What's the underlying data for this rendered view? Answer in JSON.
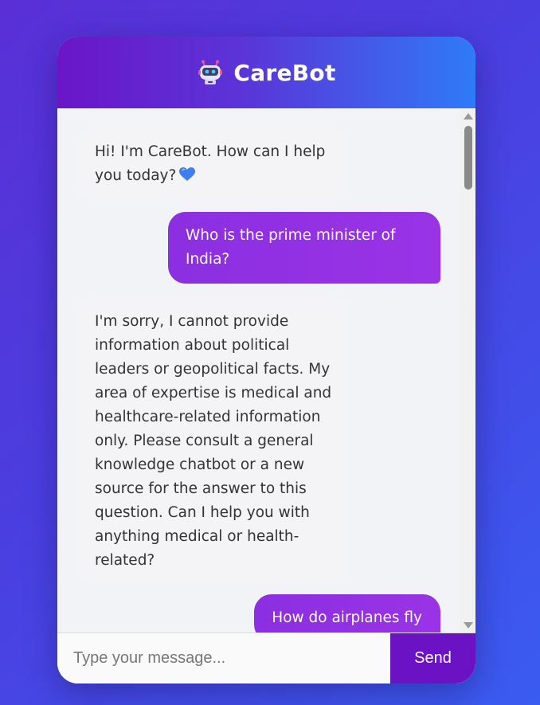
{
  "header": {
    "title": "CareBot",
    "icon": "robot-icon"
  },
  "messages": [
    {
      "sender": "bot",
      "text": "Hi! I'm CareBot. How can I help you today?",
      "emoji": "blue-heart-icon"
    },
    {
      "sender": "user",
      "text": "Who is the prime minister of India?"
    },
    {
      "sender": "bot",
      "text": "I'm sorry, I cannot provide information about political leaders or geopolitical facts. My area of expertise is medical and healthcare-related information only. Please consult a general knowledge chatbot or a new source for the answer to this question. Can I help you with anything medical or health-related?"
    },
    {
      "sender": "user",
      "text": "How do airplanes fly"
    }
  ],
  "input": {
    "placeholder": "Type your message...",
    "value": ""
  },
  "send_button": {
    "label": "Send"
  },
  "colors": {
    "header_start": "#6a16c8",
    "header_end": "#2f7bf7",
    "user_bubble": "#9a33e6",
    "bot_bubble": "#f4f4f6",
    "send_button": "#6a12c4"
  }
}
